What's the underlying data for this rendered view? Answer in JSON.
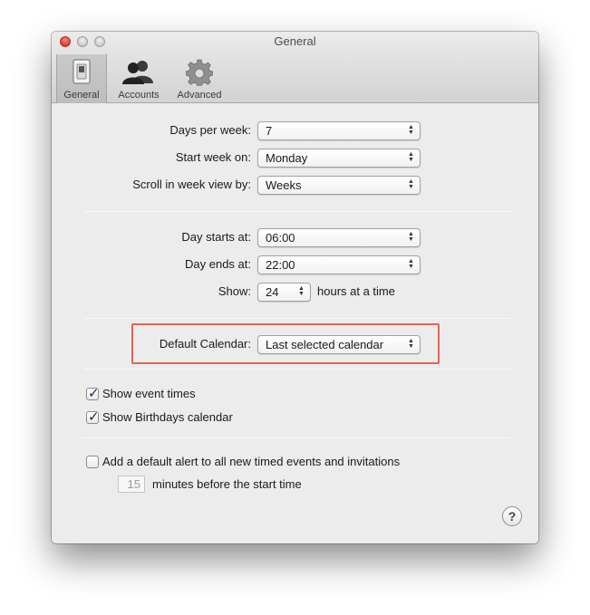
{
  "window": {
    "title": "General"
  },
  "toolbar": {
    "items": [
      {
        "label": "General",
        "icon": "switch-icon",
        "selected": true
      },
      {
        "label": "Accounts",
        "icon": "people-icon",
        "selected": false
      },
      {
        "label": "Advanced",
        "icon": "gear-icon",
        "selected": false
      }
    ]
  },
  "week": {
    "days_per_week_label": "Days per week:",
    "days_per_week_value": "7",
    "start_week_label": "Start week on:",
    "start_week_value": "Monday",
    "scroll_label": "Scroll in week view by:",
    "scroll_value": "Weeks"
  },
  "day": {
    "starts_label": "Day starts at:",
    "starts_value": "06:00",
    "ends_label": "Day ends at:",
    "ends_value": "22:00",
    "show_label": "Show:",
    "show_value": "24",
    "show_suffix": "hours at a time"
  },
  "calendar": {
    "default_label": "Default Calendar:",
    "default_value": "Last selected calendar"
  },
  "checks": {
    "show_event_times": "Show event times",
    "show_event_times_checked": true,
    "show_birthdays": "Show Birthdays calendar",
    "show_birthdays_checked": true
  },
  "alert": {
    "label": "Add a default alert to all new timed events and invitations",
    "checked": false,
    "minutes_value": "15",
    "minutes_suffix": "minutes before the start time"
  },
  "help": {
    "label": "?"
  },
  "colors": {
    "highlight": "#e06655",
    "window_bg": "#ececec"
  }
}
